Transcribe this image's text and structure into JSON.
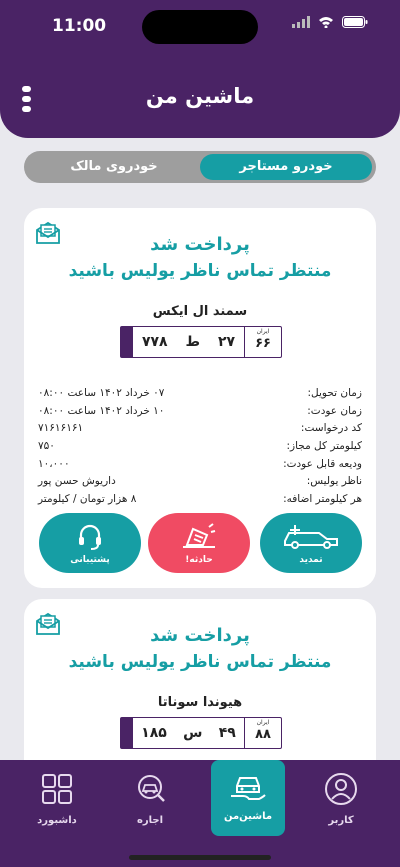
{
  "status": {
    "time": "11:00"
  },
  "header": {
    "title": "ماشین من"
  },
  "segment": {
    "active": "خودرو مستاجر",
    "inactive": "خودروی مالک"
  },
  "cards": [
    {
      "status_title": "پرداخت شد",
      "status_sub": "منتظر تماس ناظر یولیس باشید",
      "car_name": "سمند ال ایکس",
      "plate": {
        "p1": "۲۷",
        "letter": "ط",
        "p2": "۷۷۸",
        "region_label": "ایران",
        "region": "۶۶"
      },
      "details": [
        {
          "label": "زمان تحویل:",
          "value": "۰۷ خرداد ۱۴۰۲ ساعت ۰۸:۰۰"
        },
        {
          "label": "زمان عودت:",
          "value": "۱۰ خرداد ۱۴۰۲ ساعت ۰۸:۰۰"
        },
        {
          "label": "کد درخواست:",
          "value": "۷۱۶۱۶۱۶۱"
        },
        {
          "label": "کیلومتر کل مجاز:",
          "value": "۷۵۰"
        },
        {
          "label": "ودیعه قابل عودت:",
          "value": "۱۰،۰۰۰"
        },
        {
          "label": "ناظر یولیس:",
          "value": "داریوش حسن پور"
        },
        {
          "label": "هر کیلومتر اضافه:",
          "value": "۸ هزار تومان / کیلومتر"
        }
      ],
      "actions": {
        "extend": "تمدید",
        "accident": "حادثه!",
        "support": "پشتیبانی"
      }
    },
    {
      "status_title": "پرداخت شد",
      "status_sub": "منتظر تماس ناظر یولیس باشید",
      "car_name": "هیوندا سوناتا",
      "plate": {
        "p1": "۴۹",
        "letter": "س",
        "p2": "۱۸۵",
        "region_label": "ایران",
        "region": "۸۸"
      }
    }
  ],
  "nav": {
    "user": "کاربر",
    "mycar": "ماشین‌من",
    "rent": "اجاره",
    "dashboard": "داشبورد"
  },
  "colors": {
    "primary": "#4a2365",
    "accent": "#169ea4",
    "danger": "#f04b63"
  }
}
